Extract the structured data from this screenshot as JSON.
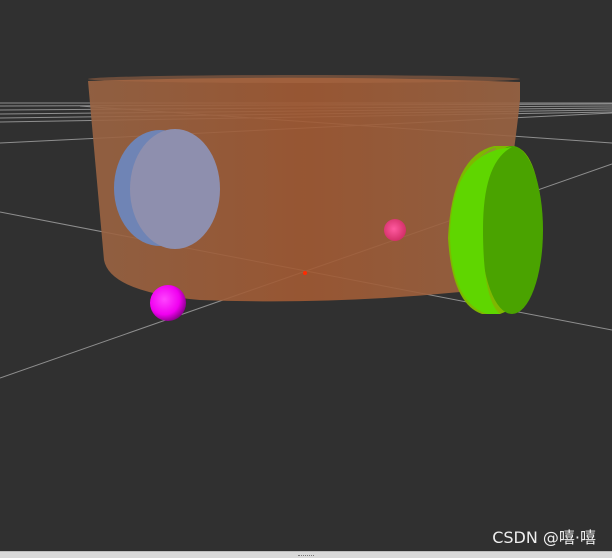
{
  "viewport": {
    "watermark": "CSDN @嘻·嘻",
    "icons": {
      "splitter": "drag-handle-icon"
    }
  },
  "scene": {
    "background_color": "#303030",
    "grid_color": "#a0a0a0",
    "objects": [
      {
        "name": "robot-base-cylinder",
        "color": "#a0603a"
      },
      {
        "name": "caster-sphere-left",
        "color": "#ff00ff"
      },
      {
        "name": "sensor-sphere",
        "color": "#ff3d8a"
      },
      {
        "name": "lidar-disc",
        "color": "#7a8fb8"
      },
      {
        "name": "drive-wheel-green",
        "color": "#5fd600"
      },
      {
        "name": "origin-marker",
        "color": "#ff2a00"
      }
    ]
  }
}
